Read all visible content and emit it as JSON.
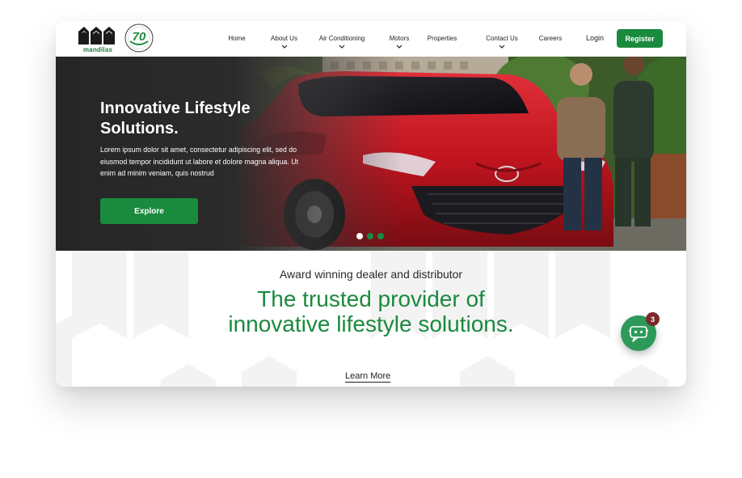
{
  "brand": {
    "logo_text": "mandilas",
    "badge_number": "70"
  },
  "nav": {
    "items": [
      {
        "label": "Home",
        "has_dropdown": false
      },
      {
        "label": "About Us",
        "has_dropdown": true
      },
      {
        "label": "Air Conditioning",
        "has_dropdown": true
      },
      {
        "label": "Motors",
        "has_dropdown": true
      },
      {
        "label": "Properties",
        "has_dropdown": false
      },
      {
        "label": "Contact Us",
        "has_dropdown": true
      },
      {
        "label": "Careers",
        "has_dropdown": false
      }
    ],
    "login_label": "Login",
    "register_label": "Register"
  },
  "hero": {
    "title": "Innovative Lifestyle Solutions.",
    "body": "Lorem ipsum dolor sit amet, consectetur adipiscing elit, sed do eiusmod tempor incididunt ut labore et dolore magna aliqua. Ut enim ad minim veniam, quis nostrud",
    "cta_label": "Explore",
    "slides": 3,
    "active_slide": 1
  },
  "intro": {
    "eyebrow": "Award winning dealer and distributor",
    "headline": "The trusted provider of innovative lifestyle solutions.",
    "link_label": "Learn More"
  },
  "chat": {
    "unread_count": "3"
  },
  "colors": {
    "brand_green": "#1a8a3e",
    "car_red": "#c0141f",
    "badge_maroon": "#7a2a2a"
  }
}
